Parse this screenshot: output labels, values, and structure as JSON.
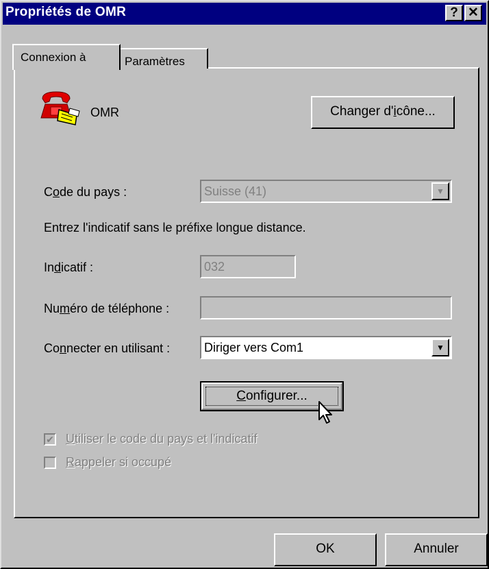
{
  "window": {
    "title": "Propriétés de OMR",
    "help_button": "?",
    "close_button": "✕"
  },
  "tabs": [
    {
      "label": "Connexion à",
      "active": true
    },
    {
      "label": "Paramètres",
      "active": false
    }
  ],
  "connection": {
    "name": "OMR",
    "change_icon_button_pre": "Changer d'",
    "change_icon_button_accel": "i",
    "change_icon_button_post": "cône..."
  },
  "country": {
    "label_pre": "C",
    "label_accel": "o",
    "label_post": "de du pays :",
    "value": "Suisse (41)"
  },
  "hint": "Entrez l'indicatif sans le préfixe longue distance.",
  "area_code": {
    "label_pre": "In",
    "label_accel": "d",
    "label_post": "icatif :",
    "value": "032"
  },
  "phone": {
    "label_pre": "Nu",
    "label_accel": "m",
    "label_post": "éro de téléphone :",
    "value": ""
  },
  "connect_using": {
    "label_pre": "Co",
    "label_accel": "n",
    "label_post": "necter en utilisant :",
    "value": "Diriger vers Com1"
  },
  "configure_button": {
    "accel": "C",
    "post": "onfigurer..."
  },
  "checkboxes": [
    {
      "accel": "U",
      "post": "tiliser le code du pays et l'indicatif",
      "checked": true
    },
    {
      "accel": "R",
      "post": "appeler si occupé",
      "checked": false
    }
  ],
  "buttons": {
    "ok": "OK",
    "cancel": "Annuler"
  }
}
